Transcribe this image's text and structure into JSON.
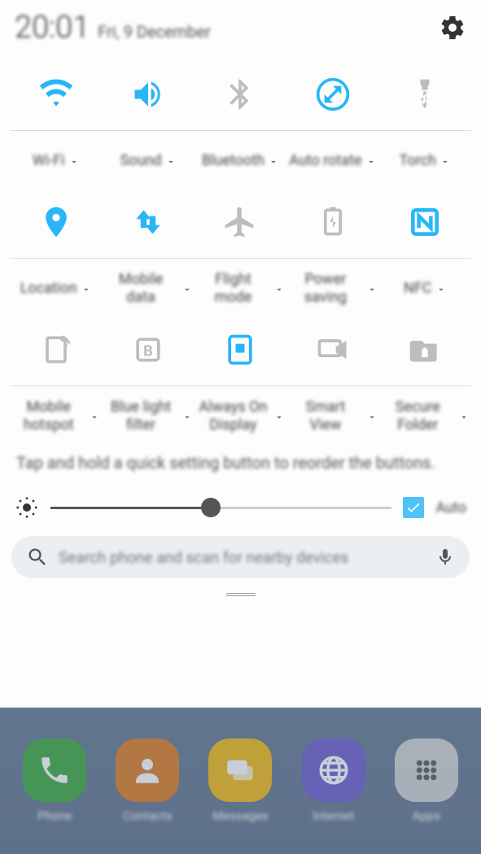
{
  "header": {
    "time": "20:01",
    "date": "Fri, 9 December"
  },
  "tiles": [
    {
      "label": "Wi-Fi",
      "icon": "wifi",
      "active": true
    },
    {
      "label": "Sound",
      "icon": "sound",
      "active": true
    },
    {
      "label": "Bluetooth",
      "icon": "bluetooth",
      "active": false
    },
    {
      "label": "Auto rotate",
      "icon": "rotate",
      "active": true
    },
    {
      "label": "Torch",
      "icon": "torch",
      "active": false
    },
    {
      "label": "Location",
      "icon": "location",
      "active": true
    },
    {
      "label": "Mobile data",
      "icon": "mobiledata",
      "active": true
    },
    {
      "label": "Flight mode",
      "icon": "flight",
      "active": false
    },
    {
      "label": "Power saving",
      "icon": "power",
      "active": false
    },
    {
      "label": "NFC",
      "icon": "nfc",
      "active": true
    },
    {
      "label": "Mobile hotspot",
      "icon": "hotspot",
      "active": false
    },
    {
      "label": "Blue light filter",
      "icon": "bluelight",
      "active": false
    },
    {
      "label": "Always On Display",
      "icon": "aod",
      "active": true
    },
    {
      "label": "Smart View",
      "icon": "smartview",
      "active": false
    },
    {
      "label": "Secure Folder",
      "icon": "securefolder",
      "active": false
    }
  ],
  "help_text": "Tap and hold a quick setting button to reorder the buttons.",
  "brightness": {
    "value_pct": 47,
    "auto_label": "Auto",
    "auto_checked": true
  },
  "search": {
    "placeholder": "Search phone and scan for nearby devices"
  },
  "dock": [
    {
      "label": "Phone",
      "color": "#3aa83a",
      "icon": "phone"
    },
    {
      "label": "Contacts",
      "color": "#e07a1c",
      "icon": "contact"
    },
    {
      "label": "Messages",
      "color": "#f2b90e",
      "icon": "message"
    },
    {
      "label": "Internet",
      "color": "#6a5acd",
      "icon": "globe"
    },
    {
      "label": "Apps",
      "color": "#d0d0d0",
      "icon": "apps"
    }
  ]
}
